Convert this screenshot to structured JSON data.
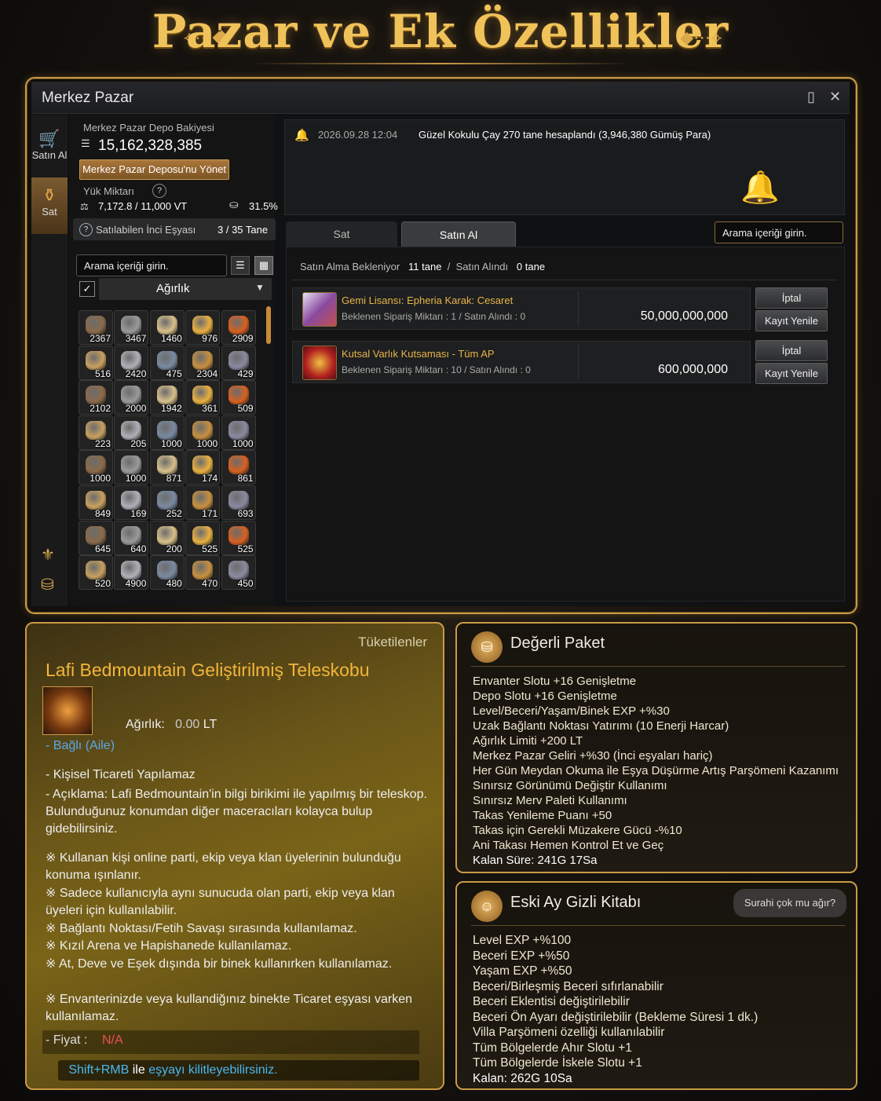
{
  "banner": {
    "title": "Pazar ve Ek Özellikler"
  },
  "window": {
    "title": "Merkez Pazar"
  },
  "sidebar": {
    "buy_label": "Satın Al",
    "sell_label": "Sat"
  },
  "left": {
    "deposit_label": "Merkez Pazar Depo Bakiyesi",
    "deposit_value": "15,162,328,385",
    "manage_button": "Merkez Pazar Deposu'nu Yönet",
    "weight_label": "Yük Miktarı",
    "weight_value": "7,172.8 / 11,000 VT",
    "weight_percent": "31.5%",
    "sellable_label": "Satılabilen İnci Eşyası",
    "sellable_value": "3 / 35 Tane",
    "search_placeholder": "Arama içeriği girin.",
    "sort_label": "Ağırlık",
    "grid_counts": [
      "2367",
      "3467",
      "1460",
      "976",
      "2909",
      "516",
      "2420",
      "475",
      "2304",
      "429",
      "2102",
      "2000",
      "1942",
      "361",
      "509",
      "223",
      "205",
      "1000",
      "1000",
      "1000",
      "1000",
      "1000",
      "871",
      "174",
      "861",
      "849",
      "169",
      "252",
      "171",
      "693",
      "645",
      "640",
      "200",
      "525",
      "525",
      "520",
      "4900",
      "480",
      "470",
      "450"
    ]
  },
  "notice": {
    "timestamp": "2026.09.28 12:04",
    "message": "Güzel Kokulu Çay 270 tane hesaplandı (3,946,380 Gümüş Para)"
  },
  "tabs": {
    "sell": "Sat",
    "buy": "Satın Al",
    "search_placeholder": "Arama içeriği girin."
  },
  "orders_summary": {
    "pending_label": "Satın Alma Bekleniyor",
    "pending_count": "11",
    "unit": "tane",
    "sep": "/",
    "bought_label": "Satın Alındı",
    "bought_count": "0"
  },
  "orders": [
    {
      "name": "Gemi Lisansı: Epheria Karak: Cesaret",
      "sub": "Beklenen Sipariş Miktarı : 1 / Satın Alındı : 0",
      "price": "50,000,000,000",
      "cancel": "İptal",
      "renew": "Kayıt Yenile"
    },
    {
      "name": "Kutsal Varlık Kutsaması - Tüm AP",
      "sub": "Beklenen Sipariş Miktarı : 10 / Satın Alındı : 0",
      "price": "600,000,000",
      "cancel": "İptal",
      "renew": "Kayıt Yenile"
    }
  ],
  "tooltip": {
    "category": "Tüketilenler",
    "name": "Lafi Bedmountain Geliştirilmiş Teleskobu",
    "weight_label": "Ağırlık:",
    "weight_value": "0.00",
    "weight_unit": "LT",
    "bound": "- Bağlı (Aile)",
    "no_trade": "- Kişisel Ticareti Yapılamaz",
    "description": "- Açıklama: Lafi Bedmountain'in bilgi birikimi ile yapılmış bir teleskop. Bulunduğunuz konumdan diğer maceracıları kolayca bulup gidebilirsiniz.",
    "notes": [
      "※ Kullanan kişi online parti, ekip veya klan üyelerinin bulunduğu konuma ışınlanır.",
      "※ Sadece kullanıcıyla aynı sunucuda olan parti, ekip veya klan üyeleri için kullanılabilir.",
      "※ Bağlantı Noktası/Fetih Savaşı sırasında kullanılamaz.",
      "※ Kızıl Arena ve Hapishanede kullanılamaz.",
      "※ At, Deve ve Eşek dışında bir binek kullanırken kullanılamaz.",
      "※ Envanterinizde veya kullandiğınız binekte Ticaret eşyası varken kullanılamaz."
    ],
    "price_label": "- Fiyat :",
    "price_value": "N/A",
    "lock_key": "Shift+RMB",
    "lock_mid": "ile",
    "lock_end": "eşyayı kilitleyebilirsiniz."
  },
  "package": {
    "title": "Değerli Paket",
    "items": [
      "Envanter Slotu +16 Genişletme",
      "Depo Slotu +16 Genişletme",
      "Level/Beceri/Yaşam/Binek EXP +%30",
      "Uzak Bağlantı Noktası Yatırımı (10 Enerji Harcar)",
      "Ağırlık Limiti +200 LT",
      "Merkez Pazar Geliri +%30 (İnci eşyaları hariç)",
      "Her Gün Meydan Okuma ile Eşya Düşürme Artış Parşömeni Kazanımı",
      "Sınırsız Görünümü Değiştir Kullanımı",
      "Sınırsız Merv Paleti Kullanımı",
      "Takas Yenileme Puanı +50",
      "Takas için Gerekli Müzakere Gücü -%10",
      "Ani Takası Hemen Kontrol Et ve Geç"
    ],
    "remaining": "Kalan Süre: 241G 17Sa"
  },
  "book": {
    "title": "Eski Ay Gizli Kitabı",
    "bubble": "Surahi çok mu ağır?",
    "items": [
      "Level EXP +%100",
      "Beceri EXP +%50",
      "Yaşam EXP +%50",
      "Beceri/Birleşmiş Beceri sıfırlanabilir",
      "Beceri Eklentisi değiştirilebilir",
      "Beceri Ön Ayarı değiştirilebilir (Bekleme Süresi 1 dk.)",
      "Villa Parşömeni özelliği kullanılabilir",
      "Tüm Bölgelerde Ahır Slotu +1",
      "Tüm Bölgelerde İskele Slotu +1"
    ],
    "remaining": "Kalan: 262G 10Sa"
  }
}
